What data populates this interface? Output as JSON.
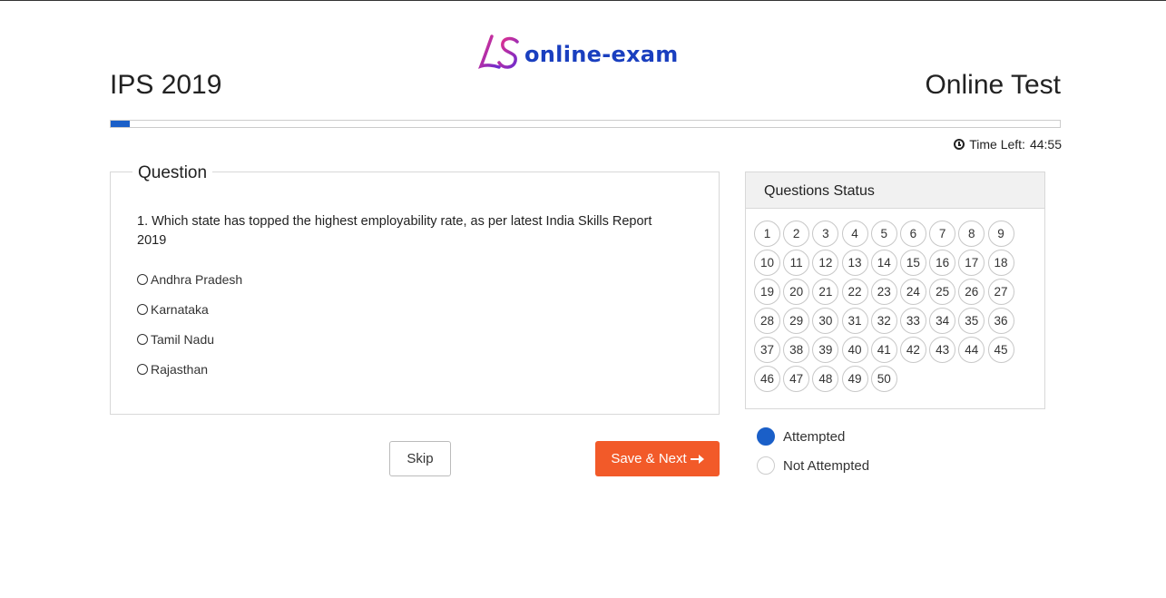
{
  "logo": {
    "monogram": "LS",
    "text": "online-exam"
  },
  "header": {
    "exam_title": "IPS 2019",
    "test_title": "Online Test"
  },
  "progress": {
    "fraction": 0.02
  },
  "timer": {
    "label": "Time Left:",
    "value": "44:55"
  },
  "question": {
    "legend": "Question",
    "text": "1. Which state has topped the highest employability rate, as per latest India Skills Report 2019",
    "options": [
      "Andhra Pradesh",
      "Karnataka",
      "Tamil Nadu",
      "Rajasthan"
    ]
  },
  "buttons": {
    "skip": "Skip",
    "save_next": "Save & Next"
  },
  "status": {
    "title": "Questions Status",
    "numbers": [
      "1",
      "2",
      "3",
      "4",
      "5",
      "6",
      "7",
      "8",
      "9",
      "10",
      "11",
      "12",
      "13",
      "14",
      "15",
      "16",
      "17",
      "18",
      "19",
      "20",
      "21",
      "22",
      "23",
      "24",
      "25",
      "26",
      "27",
      "28",
      "29",
      "30",
      "31",
      "32",
      "33",
      "34",
      "35",
      "36",
      "37",
      "38",
      "39",
      "40",
      "41",
      "42",
      "43",
      "44",
      "45",
      "46",
      "47",
      "48",
      "49",
      "50"
    ]
  },
  "legend": {
    "attempted": "Attempted",
    "not_attempted": "Not Attempted"
  },
  "colors": {
    "brand_blue": "#1a5fc8",
    "accent_orange": "#f25a29"
  }
}
